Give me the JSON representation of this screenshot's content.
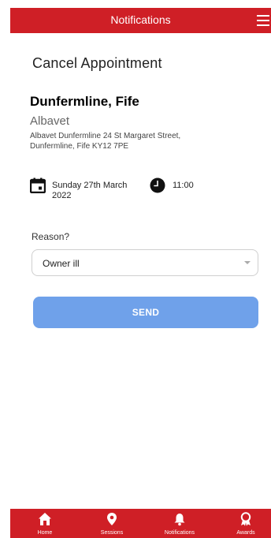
{
  "header": {
    "title": "Notifications",
    "menu_icon": "hamburger-menu-icon"
  },
  "page": {
    "title": "Cancel Appointment"
  },
  "clinic": {
    "name": "Dunfermline, Fife",
    "subtitle": "Albavet",
    "address": "Albavet Dunfermline 24 St Margaret Street, Dunfermline,  Fife KY12 7PE"
  },
  "appointment": {
    "date_icon": "calendar-icon",
    "date": "Sunday 27th March 2022",
    "time_icon": "clock-icon",
    "time": "11:00"
  },
  "reason": {
    "label": "Reason?",
    "selected": "Owner ill"
  },
  "send_button": {
    "label": "SEND",
    "color": "#6fa1ea"
  },
  "bottom_nav": {
    "items": [
      {
        "label": "Home",
        "icon": "home-icon"
      },
      {
        "label": "Sessions",
        "icon": "location-pin-icon"
      },
      {
        "label": "Notifications",
        "icon": "bell-icon"
      },
      {
        "label": "Awards",
        "icon": "award-icon"
      }
    ]
  },
  "colors": {
    "brand_red": "#cf1f26",
    "text": "#222222",
    "muted": "#666666"
  }
}
